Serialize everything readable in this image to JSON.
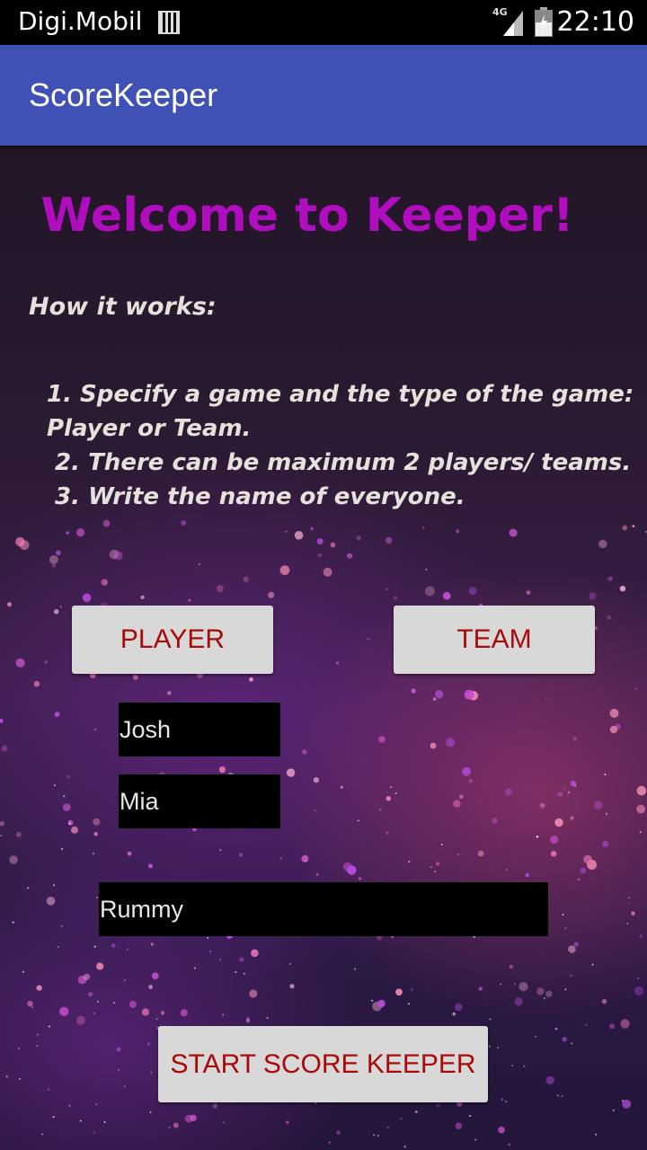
{
  "status_bar": {
    "carrier": "Digi.Mobil",
    "network_type": "4G",
    "time": "22:10",
    "icons": [
      "sim-icon",
      "signal-icon",
      "battery-icon"
    ]
  },
  "app_bar": {
    "title": "ScoreKeeper",
    "color": "#3F51B5"
  },
  "main": {
    "welcome_title": "Welcome to Keeper!",
    "welcome_color": "#B00DBE",
    "how_it_works_label": "How it works:",
    "steps": [
      "1. Specify a game and the type of the game:",
      "Player or Team.",
      " 2. There can be maximum 2 players/ teams.",
      " 3. Write the name of everyone."
    ],
    "player_button_label": "PLAYER",
    "team_button_label": "TEAM",
    "name_fields": [
      {
        "value": "Josh"
      },
      {
        "value": "Mia"
      }
    ],
    "game_field": {
      "value": "Rummy"
    },
    "start_button_label": "START SCORE KEEPER",
    "button_text_color": "#A80A0A"
  }
}
